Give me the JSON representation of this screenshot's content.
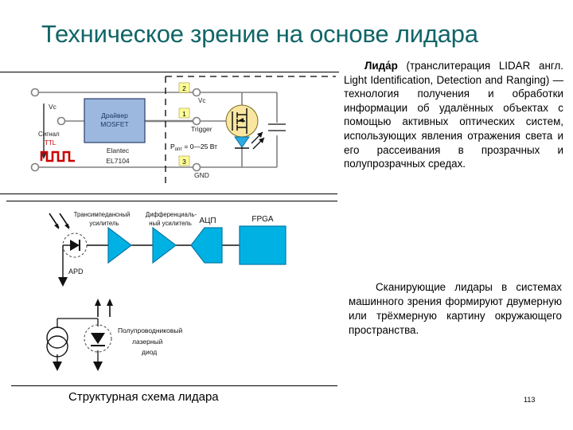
{
  "slide": {
    "title": "Техническое зрение на основе лидара",
    "title_color": "#116567",
    "page_number": "113",
    "caption": "Структурная схема лидара"
  },
  "body": {
    "paragraph1_lead": "Лида́р",
    "paragraph1_rest": " (транслитерация LIDAR англ. Light Identification, Detection and Ranging) — технология получения и обработки информации об удалённых объектах с помощью активных оптических систем, использующих явления отражения света и его рассеивания в прозрачных и полупрозрачных средах.",
    "paragraph2": "Сканирующие лидары в системах машинного зрения формируют двумерную или трёхмерную картину окружающего пространства."
  },
  "figure_driver": {
    "name": "Схема драйвера лазерного диода",
    "supply_label": "Vc",
    "signal_label": "Сигнал",
    "signal_label2": "TTL",
    "driver_box_line1": "Драйвер",
    "driver_box_line2": "MOSFET",
    "driver_part_line1": "Elantec",
    "driver_part_line2": "EL7104",
    "pin2": "2",
    "pin1": "1",
    "pin3": "3",
    "pin2_label": "Vc",
    "pin1_label": "Trigger",
    "pin3_label": "GND",
    "power_label": "P",
    "power_sub": "опт",
    "power_value": " = 0—25 Вт",
    "box_fill": "#9DB8DE",
    "pin_fill": "#FFFF99",
    "led_fill": "#29ABE2",
    "mosfet_fill": "#FAE6A0",
    "ttl_color": "#CC0000"
  },
  "figure_receiver": {
    "name": "Приёмный тракт",
    "photodiode_label": "APD",
    "tia_line1": "Трансимпедансный",
    "tia_line2": "усилитель",
    "diff_line1": "Дифференциаль-",
    "diff_line2": "ный усилитель",
    "adc_label": "АЦП",
    "fpga_label": "FPGA",
    "block_fill": "#00B2E3"
  },
  "figure_laser": {
    "name": "Лазерный диод с источником тока",
    "label_line1": "Полупроводниковый",
    "label_line2": "лазерный",
    "label_line3": "диод"
  }
}
